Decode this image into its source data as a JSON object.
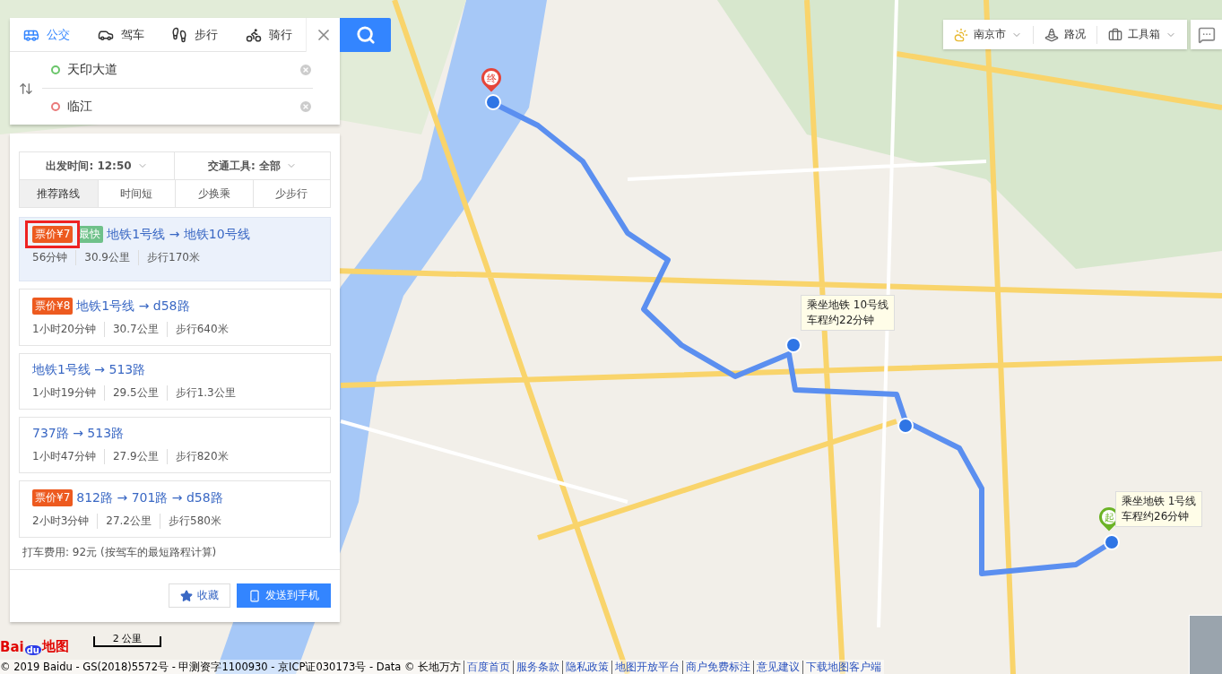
{
  "mode_tabs": [
    {
      "label": "公交",
      "kind": "bus",
      "selected": true
    },
    {
      "label": "驾车",
      "kind": "car",
      "selected": false
    },
    {
      "label": "步行",
      "kind": "walk",
      "selected": false
    },
    {
      "label": "骑行",
      "kind": "bike",
      "selected": false
    }
  ],
  "origin": {
    "value": "天印大道"
  },
  "destination": {
    "value": "临江"
  },
  "filters": [
    {
      "label": "出发时间:",
      "value": "12:50"
    },
    {
      "label": "交通工具:",
      "value": "全部"
    }
  ],
  "sort_tabs": [
    {
      "label": "推荐路线",
      "selected": true
    },
    {
      "label": "时间短",
      "selected": false
    },
    {
      "label": "少换乘",
      "selected": false
    },
    {
      "label": "少步行",
      "selected": false
    }
  ],
  "routes": [
    {
      "fare": "票价¥7",
      "fare_highlighted": true,
      "tag": "最快",
      "title": "地铁1号线 → 地铁10号线",
      "duration": "56分钟",
      "distance": "30.9公里",
      "walk": "步行170米",
      "selected": true
    },
    {
      "fare": "票价¥8",
      "fare_highlighted": false,
      "title": "地铁1号线 → d58路",
      "duration": "1小时20分钟",
      "distance": "30.7公里",
      "walk": "步行640米",
      "selected": false
    },
    {
      "title": "地铁1号线 → 513路",
      "duration": "1小时19分钟",
      "distance": "29.5公里",
      "walk": "步行1.3公里",
      "selected": false
    },
    {
      "title": "737路 → 513路",
      "duration": "1小时47分钟",
      "distance": "27.9公里",
      "walk": "步行820米",
      "selected": false
    },
    {
      "fare": "票价¥7",
      "fare_highlighted": false,
      "title": "812路 → 701路 → d58路",
      "duration": "2小时3分钟",
      "distance": "27.2公里",
      "walk": "步行580米",
      "selected": false
    }
  ],
  "taxi_note": "打车费用: 92元 (按驾车的最短路程计算)",
  "actions": [
    {
      "label": "收藏",
      "kind": "favorite"
    },
    {
      "label": "发送到手机",
      "kind": "send"
    }
  ],
  "toolbar": [
    {
      "label": "南京市",
      "kind": "city"
    },
    {
      "label": "路况",
      "kind": "traffic"
    },
    {
      "label": "工具箱",
      "kind": "tools"
    }
  ],
  "map": {
    "end_pin": "终",
    "start_pin": "起",
    "callouts": [
      {
        "lines": [
          "乘坐地铁 10号线",
          "车程约22分钟"
        ]
      },
      {
        "lines": [
          "乘坐地铁 1号线",
          "车程约26分钟"
        ]
      }
    ],
    "scale": "2 公里"
  },
  "logo": {
    "text": "Bai",
    "mark": "du",
    "suffix": "地图"
  },
  "footer": {
    "copyright": "© 2019 Baidu - GS(2018)5572号 - 甲测资字1100930 - 京ICP证030173号 - Data © 长地万方",
    "links": [
      "百度首页",
      "服务条款",
      "隐私政策",
      "地图开放平台",
      "商户免费标注",
      "意见建议",
      "下载地图客户端"
    ]
  }
}
